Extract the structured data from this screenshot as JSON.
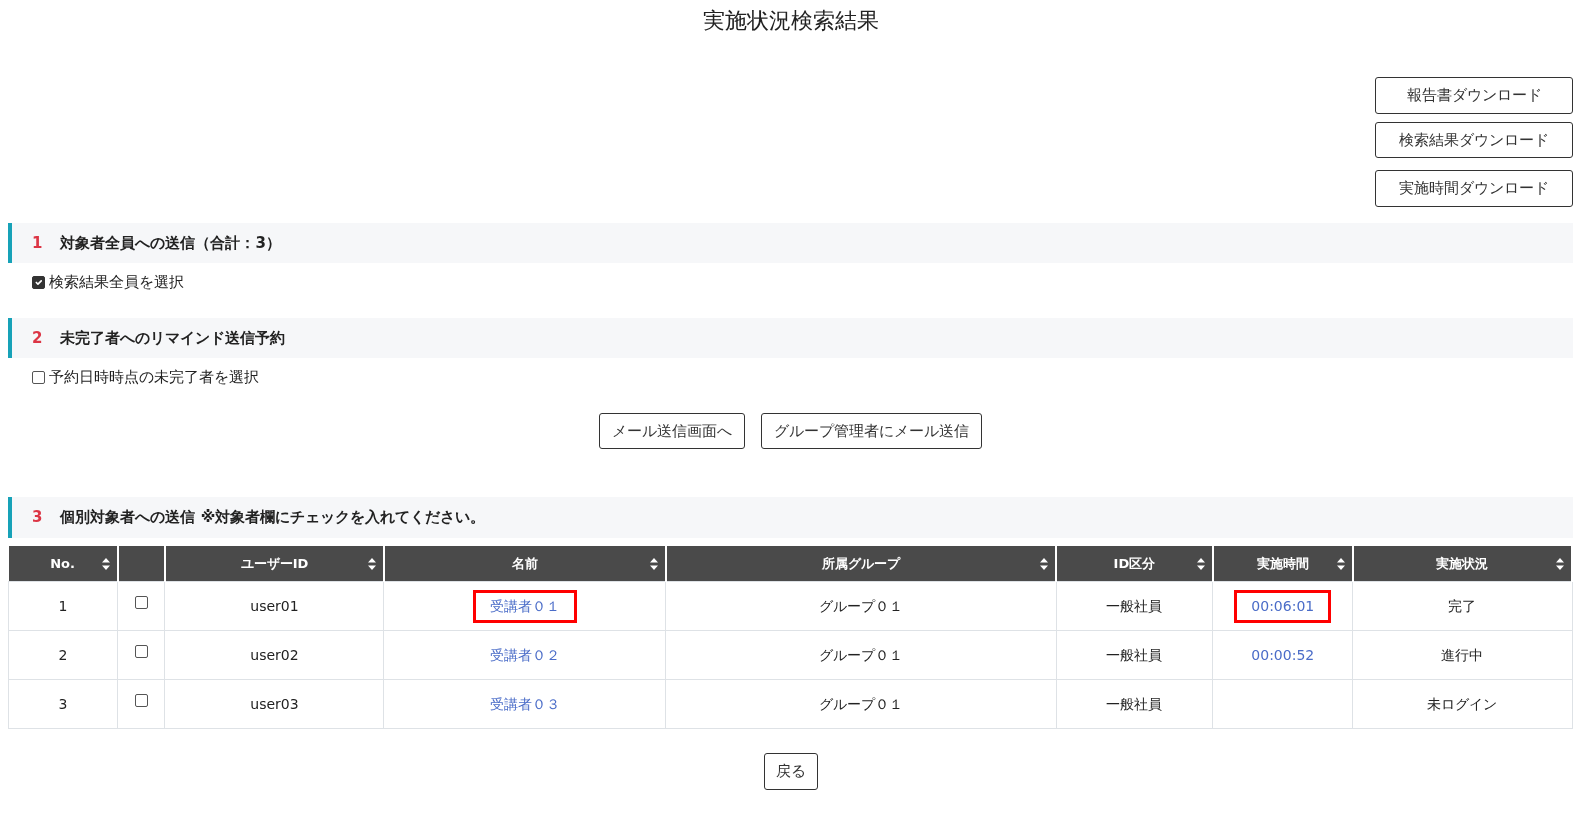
{
  "title": "実施状況検索結果",
  "downloads": [
    "報告書ダウンロード",
    "検索結果ダウンロード",
    "実施時間ダウンロード"
  ],
  "sections": [
    {
      "number": "1",
      "heading": "対象者全員への送信（合計：3）",
      "option": {
        "label": "検索結果全員を選択",
        "checked": true
      }
    },
    {
      "number": "2",
      "heading": "未完了者へのリマインド送信予約",
      "option": {
        "label": "予約日時時点の未完了者を選択",
        "checked": false
      }
    }
  ],
  "mail_buttons": [
    "メール送信画面へ",
    "グループ管理者にメール送信"
  ],
  "section3": {
    "number": "3",
    "heading": "個別対象者への送信 ※対象者欄にチェックを入れてください。"
  },
  "table": {
    "columns": [
      {
        "label": "No.",
        "sortable": true
      },
      {
        "sortable": false
      },
      {
        "label": "ユーザーID",
        "sortable": true
      },
      {
        "label": "名前",
        "sortable": true
      },
      {
        "label": "所属グループ",
        "sortable": true
      },
      {
        "label": "ID区分",
        "sortable": true
      },
      {
        "label": "実施時間",
        "sortable": true
      },
      {
        "label": "実施状況",
        "sortable": true
      }
    ],
    "rows": [
      {
        "no": "1",
        "checked": false,
        "user_id": "user01",
        "name": "受講者０１",
        "name_highlighted": true,
        "group": "グループ０１",
        "id_type": "一般社員",
        "time": "00:06:01",
        "time_highlighted": true,
        "status": "完了"
      },
      {
        "no": "2",
        "checked": false,
        "user_id": "user02",
        "name": "受講者０２",
        "name_highlighted": false,
        "group": "グループ０１",
        "id_type": "一般社員",
        "time": "00:00:52",
        "time_highlighted": false,
        "status": "進行中"
      },
      {
        "no": "3",
        "checked": false,
        "user_id": "user03",
        "name": "受講者０３",
        "name_highlighted": false,
        "group": "グループ０１",
        "id_type": "一般社員",
        "status": "未ログイン"
      }
    ]
  },
  "back_button": "戻る"
}
